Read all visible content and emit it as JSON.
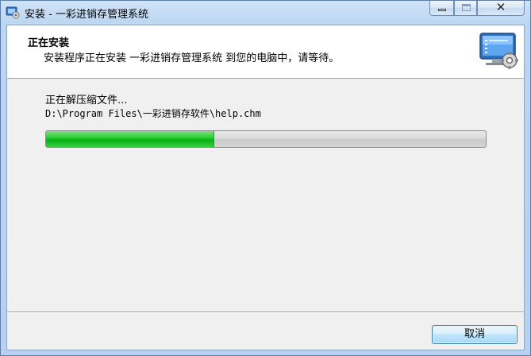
{
  "window": {
    "title": "安装 - 一彩进销存管理系统",
    "close_glyph": "✕"
  },
  "header": {
    "title": "正在安装",
    "subtitle": "安装程序正在安装 一彩进销存管理系统 到您的电脑中，请等待。"
  },
  "progress": {
    "status": "正在解压缩文件...",
    "current_file": "D:\\Program Files\\一彩进销存软件\\help.chm",
    "fraction": 0.38
  },
  "buttons": {
    "cancel": "取消"
  },
  "colors": {
    "progress_fill": "#06b012",
    "title_bar": "#bcd6f1",
    "dialog_bg": "#f0f0f0"
  }
}
